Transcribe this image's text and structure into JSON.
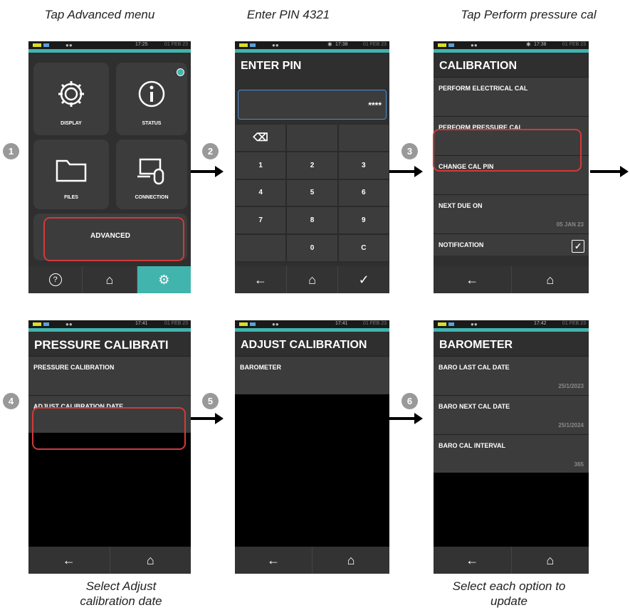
{
  "captions": {
    "c1": "Tap Advanced menu",
    "c2": "Enter PIN 4321",
    "c3": "Tap Perform pressure cal",
    "c4_line1": "Select Adjust",
    "c4_line2": "calibration date",
    "c6_line1": "Select each option to",
    "c6_line2": "update"
  },
  "steps": [
    "1",
    "2",
    "3",
    "4",
    "5",
    "6"
  ],
  "screen1": {
    "time": "17:25",
    "date": "01 FEB 23",
    "tiles": [
      "DISPLAY",
      "STATUS",
      "FILES",
      "CONNECTION"
    ],
    "advanced": "ADVANCED",
    "nav": [
      "?",
      "home",
      "settings"
    ]
  },
  "screen2": {
    "time": "17:38",
    "date": "01 FEB 23",
    "title": "ENTER PIN",
    "pin_value": "****",
    "keys": [
      "⌫",
      "",
      "",
      "1",
      "2",
      "3",
      "4",
      "5",
      "6",
      "7",
      "8",
      "9",
      "",
      "0",
      "C"
    ],
    "nav": [
      "←",
      "home",
      "✓"
    ]
  },
  "screen3": {
    "time": "17:38",
    "date": "01 FEB 23",
    "title": "CALIBRATION",
    "rows": [
      "PERFORM ELECTRICAL CAL",
      "PERFORM PRESSURE CAL",
      "CHANGE CAL PIN",
      "NEXT DUE ON",
      "NOTIFICATION"
    ],
    "next_due_value": "05 JAN 23",
    "nav": [
      "←",
      "home"
    ]
  },
  "screen4": {
    "time": "17:41",
    "date": "01 FEB 23",
    "title": "PRESSURE CALIBRATI",
    "rows": [
      "PRESSURE CALIBRATION",
      "ADJUST CALIBRATION DATE"
    ],
    "nav": [
      "←",
      "home"
    ]
  },
  "screen5": {
    "time": "17:41",
    "date": "01 FEB 23",
    "title": "ADJUST CALIBRATION",
    "rows": [
      "BAROMETER"
    ],
    "nav": [
      "←",
      "home"
    ]
  },
  "screen6": {
    "time": "17:42",
    "date": "01 FEB 23",
    "title": "BAROMETER",
    "rows": [
      "BARO LAST CAL DATE",
      "BARO NEXT CAL DATE",
      "BARO CAL INTERVAL"
    ],
    "values": [
      "25/1/2023",
      "25/1/2024",
      "365"
    ],
    "nav": [
      "←",
      "home"
    ]
  },
  "colors": {
    "accent": "#41b4ad",
    "highlight": "#d23a3a",
    "screen": "#2f2f2f"
  }
}
